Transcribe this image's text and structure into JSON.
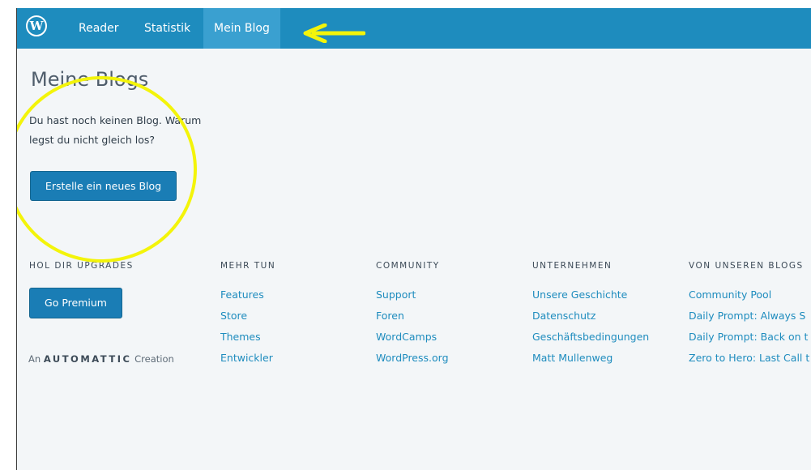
{
  "topbar": {
    "logo_icon": "wordpress-logo-icon",
    "logo_glyph": "W",
    "nav": [
      "Reader",
      "Statistik",
      "Mein Blog"
    ],
    "active_index": 2,
    "background_color": "#1e8cbe",
    "active_color": "#3aa0d0"
  },
  "main": {
    "title": "Meine Blogs",
    "intro": "Du hast noch keinen Blog. Warum legst du nicht gleich los?",
    "create_button": "Erstelle ein neues Blog"
  },
  "footer": {
    "upgrades": {
      "heading": "HOL DIR UPGRADES",
      "button": "Go Premium",
      "credit_prefix": "An",
      "credit_brand": "AUTOMATTIC",
      "credit_suffix": "Creation"
    },
    "columns": [
      {
        "heading": "MEHR TUN",
        "links": [
          "Features",
          "Store",
          "Themes",
          "Entwickler"
        ]
      },
      {
        "heading": "COMMUNITY",
        "links": [
          "Support",
          "Foren",
          "WordCamps",
          "WordPress.org"
        ]
      },
      {
        "heading": "UNTERNEHMEN",
        "links": [
          "Unsere Geschichte",
          "Datenschutz",
          "Geschäftsbedingungen",
          "Matt Mullenweg"
        ]
      },
      {
        "heading": "VON UNSEREN BLOGS",
        "links": [
          "Community Pool",
          "Daily Prompt: Always S",
          "Daily Prompt: Back on t",
          "Zero to Hero: Last Call t"
        ]
      }
    ]
  },
  "annotations": {
    "highlight_color": "#f3f40a",
    "circle": "create-blog-highlight",
    "arrow": "pointing-left-to-mein-blog"
  }
}
